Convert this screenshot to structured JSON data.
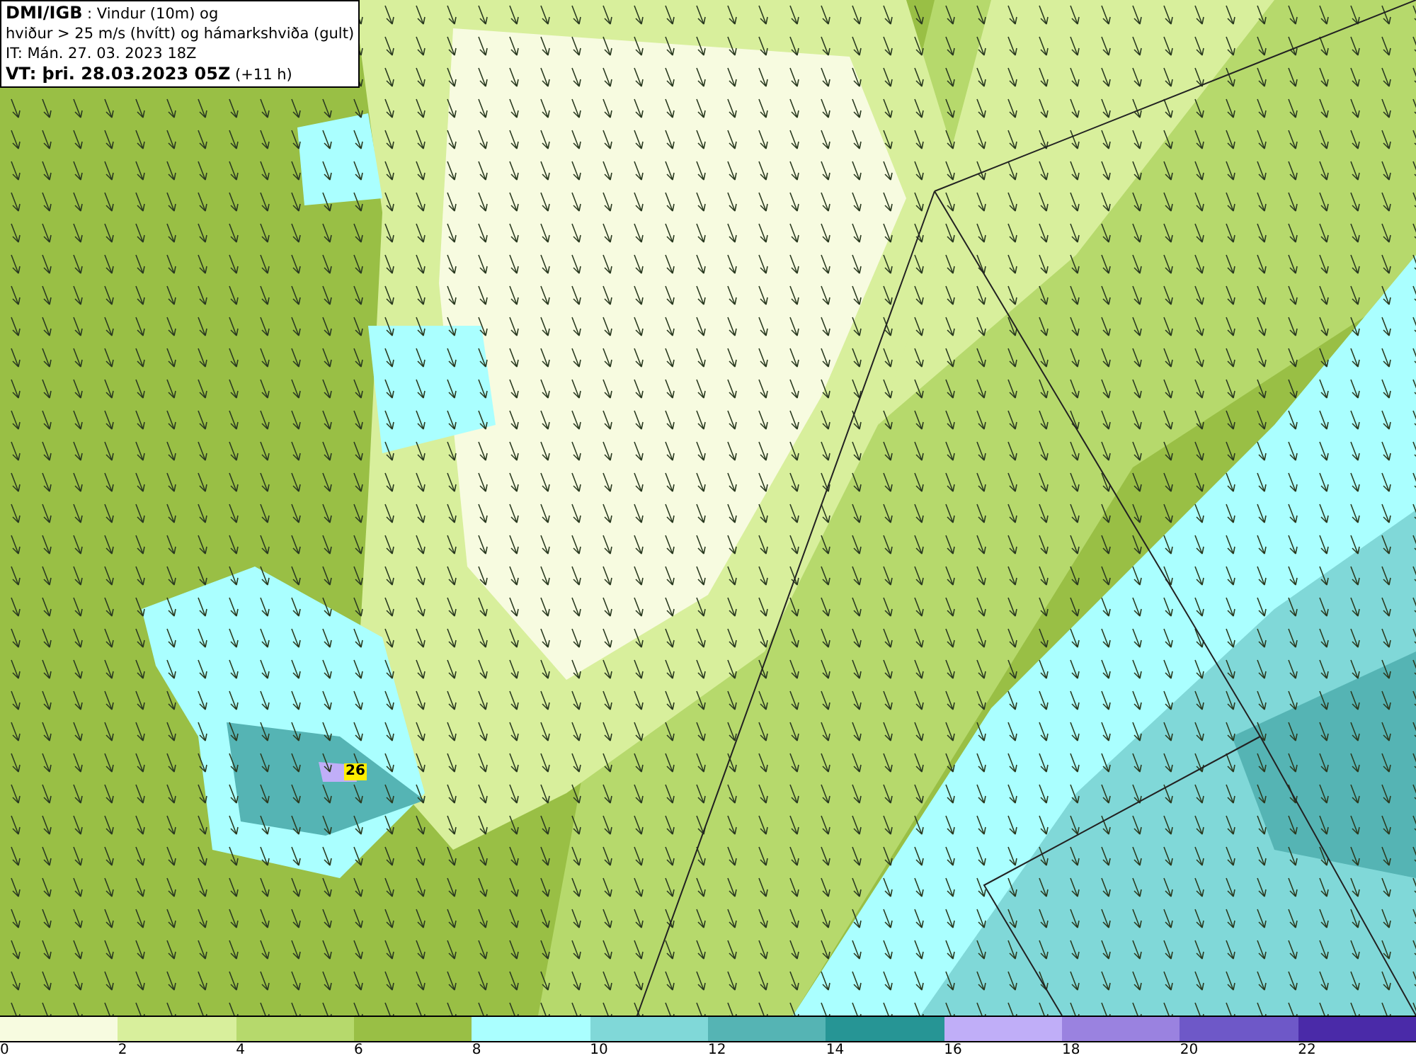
{
  "header": {
    "lines": [
      "**DMI/IGB** : Vindur (10m) og",
      "hviður > 25 m/s (hvítt) og hámarkshviða (gult)",
      "IT: Mán. 27. 03. 2023 18Z",
      "**VT: þri. 28.03.2023 05Z** (+11 h)"
    ]
  },
  "gust_marker": "26",
  "legend": {
    "bins": [
      {
        "color": "#f7fbe0"
      },
      {
        "color": "#d8ef9c"
      },
      {
        "color": "#b6d96c"
      },
      {
        "color": "#99bf45"
      },
      {
        "color": "#aaffff"
      },
      {
        "color": "#80d8d8"
      },
      {
        "color": "#55b4b4"
      },
      {
        "color": "#269595"
      },
      {
        "color": "#c0aef8"
      },
      {
        "color": "#9a82e0"
      },
      {
        "color": "#6e58c8"
      },
      {
        "color": "#4a2aa8"
      }
    ],
    "ticks": [
      "0",
      "2",
      "4",
      "6",
      "8",
      "10",
      "12",
      "14",
      "16",
      "18",
      "20",
      "22"
    ]
  }
}
